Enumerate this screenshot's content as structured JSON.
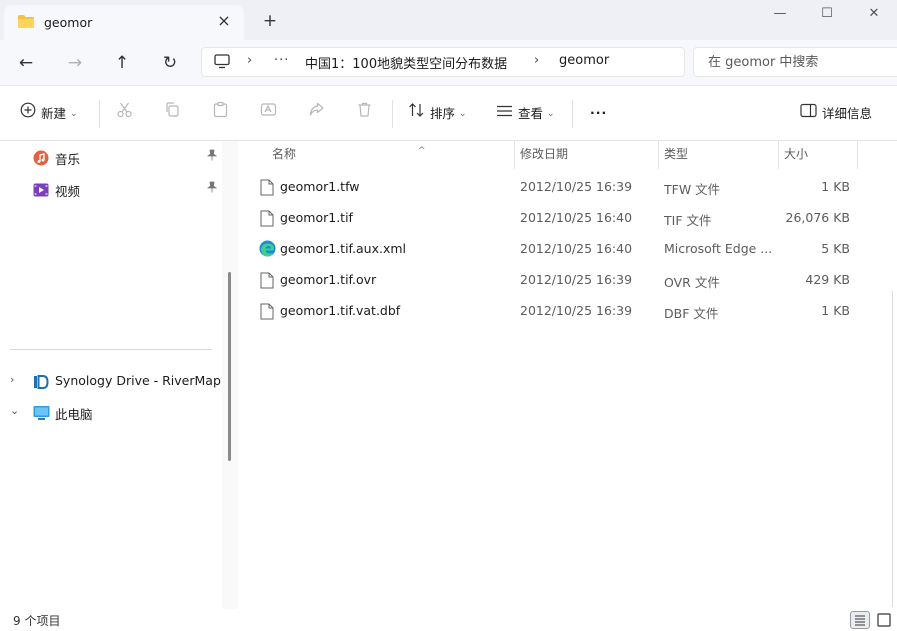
{
  "window": {
    "title": "geomor"
  },
  "address": {
    "more": "···",
    "crumbs": [
      "中国1：100地貌类型空间分布数据",
      "geomor"
    ]
  },
  "search": {
    "placeholder": "在 geomor 中搜索"
  },
  "toolbar": {
    "new_label": "新建",
    "sort_label": "排序",
    "view_label": "查看",
    "more": "···",
    "details_label": "详细信息"
  },
  "sidebar": {
    "quick": [
      {
        "label": "音乐",
        "icon": "music-icon"
      },
      {
        "label": "视频",
        "icon": "video-icon"
      }
    ],
    "tree": [
      {
        "label": "Synology Drive - RiverMap",
        "icon": "synology-drive-icon",
        "expanded": false
      },
      {
        "label": "此电脑",
        "icon": "computer-icon",
        "expanded": true
      }
    ]
  },
  "columns": {
    "name": "名称",
    "date": "修改日期",
    "type": "类型",
    "size": "大小"
  },
  "files": [
    {
      "name": "geomor1.tfw",
      "date": "2012/10/25 16:39",
      "type": "TFW 文件",
      "size": "1 KB",
      "icon": "file-icon"
    },
    {
      "name": "geomor1.tif",
      "date": "2012/10/25 16:40",
      "type": "TIF 文件",
      "size": "26,076 KB",
      "icon": "file-icon"
    },
    {
      "name": "geomor1.tif.aux.xml",
      "date": "2012/10/25 16:40",
      "type": "Microsoft Edge ...",
      "size": "5 KB",
      "icon": "edge-icon"
    },
    {
      "name": "geomor1.tif.ovr",
      "date": "2012/10/25 16:39",
      "type": "OVR 文件",
      "size": "429 KB",
      "icon": "file-icon"
    },
    {
      "name": "geomor1.tif.vat.dbf",
      "date": "2012/10/25 16:39",
      "type": "DBF 文件",
      "size": "1 KB",
      "icon": "file-icon"
    }
  ],
  "status": {
    "count": "9 个项目"
  }
}
